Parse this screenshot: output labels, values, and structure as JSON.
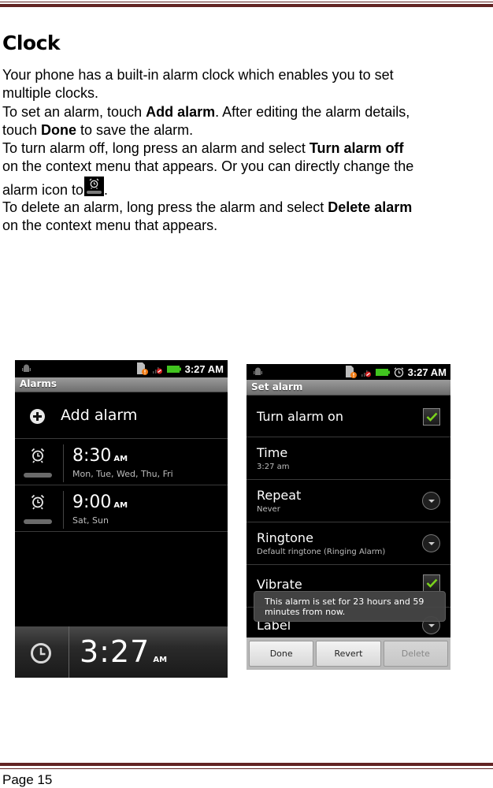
{
  "document": {
    "heading": "Clock",
    "paragraphs": {
      "p1": "Your phone has a built-in alarm clock which enables you to set",
      "p1b": "multiple clocks.",
      "p2_pre": "To set an alarm, touch ",
      "p2_bold": "Add alarm",
      "p2_post": ". After editing the alarm details,",
      "p2b_pre": "touch ",
      "p2b_bold": "Done",
      "p2b_post": " to save the alarm.",
      "p3_pre": "To turn alarm off, long press an alarm and select ",
      "p3_bold": "Turn alarm off",
      "p3b": "on the context menu that appears.  Or you can directly change the",
      "p3c_pre": "alarm icon to",
      "p3c_post": ".",
      "p4_pre": "To delete an alarm, long press the alarm and select ",
      "p4_bold": "Delete alarm",
      "p4b": "on the context menu that appears."
    },
    "footer": "Page 15",
    "accent_color": "#622423"
  },
  "alarms_screen": {
    "status_time": "3:27 AM",
    "title": "Alarms",
    "add_alarm_label": "Add alarm",
    "alarms": [
      {
        "time": "8:30",
        "ampm": "AM",
        "days": "Mon, Tue, Wed, Thu, Fri"
      },
      {
        "time": "9:00",
        "ampm": "AM",
        "days": "Sat, Sun"
      }
    ],
    "clock": {
      "time": "3:27",
      "ampm": "AM"
    }
  },
  "set_alarm_screen": {
    "status_time": "3:27 AM",
    "title": "Set alarm",
    "rows": {
      "turn_on": {
        "title": "Turn alarm on",
        "checked": true
      },
      "time": {
        "title": "Time",
        "value": "3:27 am"
      },
      "repeat": {
        "title": "Repeat",
        "value": "Never"
      },
      "ringtone": {
        "title": "Ringtone",
        "value": "Default ringtone (Ringing Alarm)"
      },
      "vibrate": {
        "title": "Vibrate",
        "checked": true
      },
      "label": {
        "title": "Label"
      }
    },
    "toast": {
      "line1": "This alarm is set for 23 hours and 59",
      "line2": "minutes from now."
    },
    "buttons": {
      "done": "Done",
      "revert": "Revert",
      "delete": "Delete"
    }
  }
}
